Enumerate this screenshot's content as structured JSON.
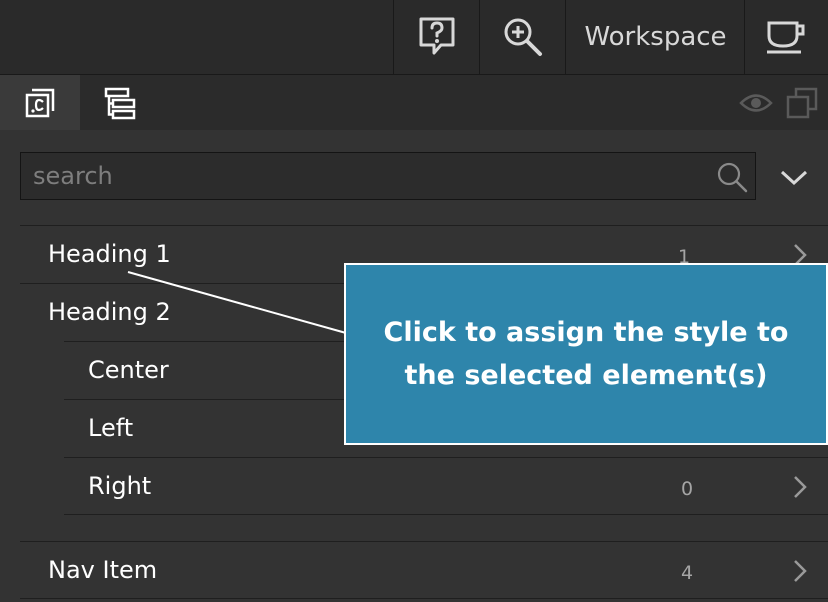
{
  "topbar": {
    "help_icon": "help-bubble-icon",
    "zoom_icon": "zoom-in-icon",
    "workspace_label": "Workspace",
    "cup_icon": "cup-icon"
  },
  "panel_tabs": [
    {
      "icon": "class-selector-icon",
      "active": true
    },
    {
      "icon": "layer-tree-icon",
      "active": false
    }
  ],
  "panel_actions": [
    {
      "icon": "eye-icon"
    },
    {
      "icon": "duplicate-icon"
    }
  ],
  "search": {
    "placeholder": "search",
    "value": ""
  },
  "styles": [
    {
      "label": "Heading 1",
      "count": "1",
      "level": 0
    },
    {
      "label": "Heading 2",
      "count": "",
      "level": 0
    },
    {
      "label": "Center",
      "count": "",
      "level": 1
    },
    {
      "label": "Left",
      "count": "",
      "level": 1
    },
    {
      "label": "Right",
      "count": "0",
      "level": 1
    },
    {
      "label": "Nav Item",
      "count": "4",
      "level": 0
    }
  ],
  "tooltip": {
    "text": "Click to assign the style to the selected element(s)"
  },
  "colors": {
    "tooltip_bg": "#2e85ab",
    "panel_bg": "#333333",
    "topbar_bg": "#2a2a2a"
  }
}
